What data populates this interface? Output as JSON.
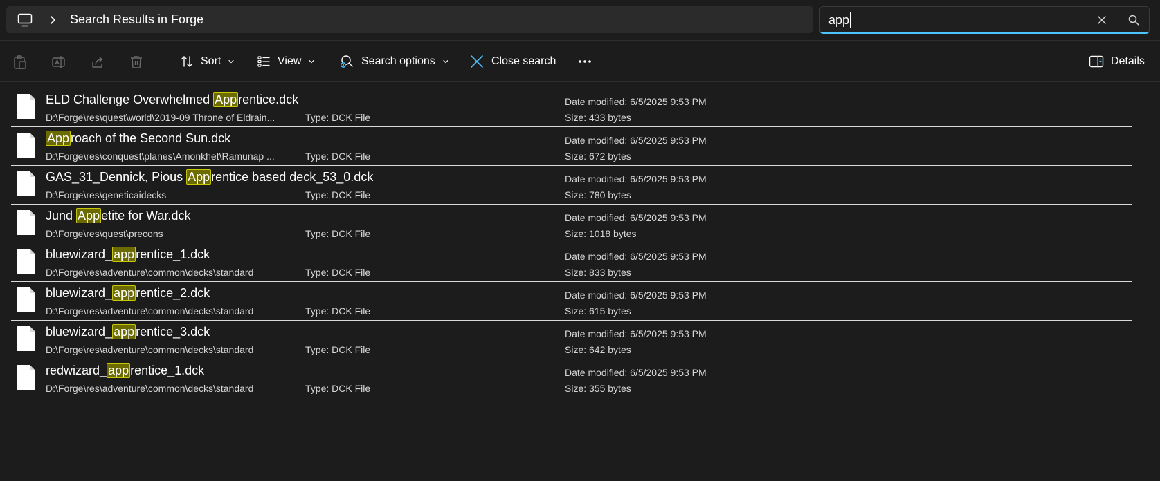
{
  "address_bar": {
    "breadcrumb": "Search Results in Forge"
  },
  "search": {
    "value": "app",
    "placeholder": ""
  },
  "commands": {
    "sort": "Sort",
    "view": "View",
    "search_options": "Search options",
    "close_search": "Close search",
    "details": "Details"
  },
  "results": [
    {
      "name_before": "ELD Challenge Overwhelmed ",
      "name_match": "App",
      "name_after": "rentice.dck",
      "path": "D:\\Forge\\res\\quest\\world\\2019-09 Throne of Eldrain...",
      "type": "Type: DCK File",
      "date": "Date modified: 6/5/2025 9:53 PM",
      "size": "Size: 433 bytes"
    },
    {
      "name_before": "",
      "name_match": "App",
      "name_after": "roach of the Second Sun.dck",
      "path": "D:\\Forge\\res\\conquest\\planes\\Amonkhet\\Ramunap ...",
      "type": "Type: DCK File",
      "date": "Date modified: 6/5/2025 9:53 PM",
      "size": "Size: 672 bytes"
    },
    {
      "name_before": "GAS_31_Dennick, Pious ",
      "name_match": "App",
      "name_after": "rentice based deck_53_0.dck",
      "path": "D:\\Forge\\res\\geneticaidecks",
      "type": "Type: DCK File",
      "date": "Date modified: 6/5/2025 9:53 PM",
      "size": "Size: 780 bytes"
    },
    {
      "name_before": "Jund ",
      "name_match": "App",
      "name_after": "etite for War.dck",
      "path": "D:\\Forge\\res\\quest\\precons",
      "type": "Type: DCK File",
      "date": "Date modified: 6/5/2025 9:53 PM",
      "size": "Size: 1018 bytes"
    },
    {
      "name_before": "bluewizard_",
      "name_match": "app",
      "name_after": "rentice_1.dck",
      "path": "D:\\Forge\\res\\adventure\\common\\decks\\standard",
      "type": "Type: DCK File",
      "date": "Date modified: 6/5/2025 9:53 PM",
      "size": "Size: 833 bytes"
    },
    {
      "name_before": "bluewizard_",
      "name_match": "app",
      "name_after": "rentice_2.dck",
      "path": "D:\\Forge\\res\\adventure\\common\\decks\\standard",
      "type": "Type: DCK File",
      "date": "Date modified: 6/5/2025 9:53 PM",
      "size": "Size: 615 bytes"
    },
    {
      "name_before": "bluewizard_",
      "name_match": "app",
      "name_after": "rentice_3.dck",
      "path": "D:\\Forge\\res\\adventure\\common\\decks\\standard",
      "type": "Type: DCK File",
      "date": "Date modified: 6/5/2025 9:53 PM",
      "size": "Size: 642 bytes"
    },
    {
      "name_before": "redwizard_",
      "name_match": "app",
      "name_after": "rentice_1.dck",
      "path": "D:\\Forge\\res\\adventure\\common\\decks\\standard",
      "type": "Type: DCK File",
      "date": "Date modified: 6/5/2025 9:53 PM",
      "size": "Size: 355 bytes"
    }
  ],
  "colors": {
    "background": "#1c1c1c",
    "address_bg": "#2b2b2b",
    "accent": "#4cc2ff",
    "highlight_bg": "#6b6b00",
    "highlight_border": "#c8c800"
  },
  "icons": {
    "location": "this-pc-icon",
    "breadcrumb_separator": "chevron-right-icon",
    "clear_search": "close-icon",
    "search": "magnify-icon",
    "file": "file-icon"
  }
}
